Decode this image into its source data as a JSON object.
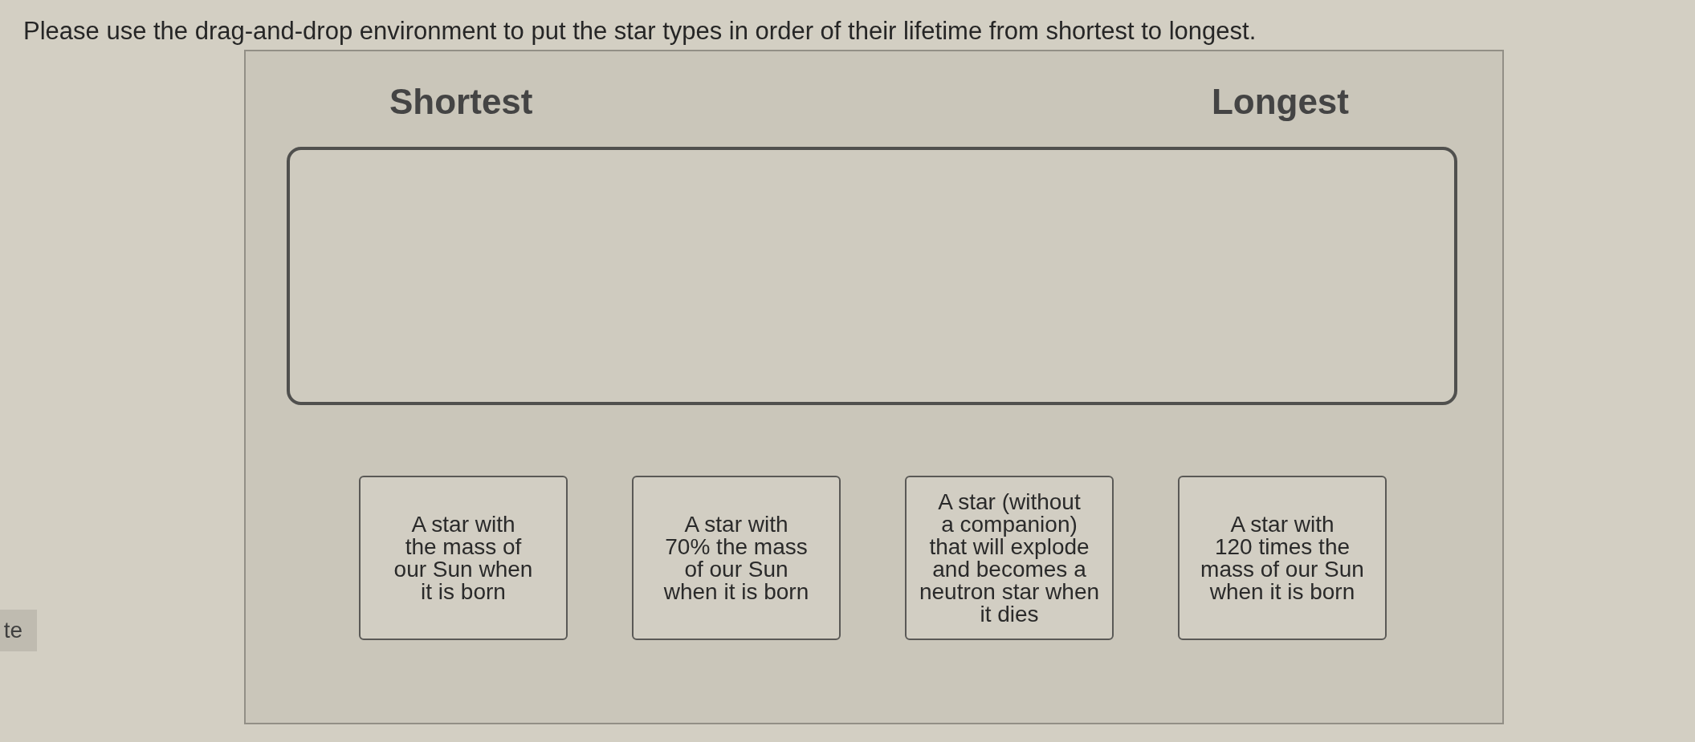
{
  "instruction": "Please use the drag-and-drop environment to put the star types in order of their lifetime from shortest to longest.",
  "side_button": {
    "label": "te"
  },
  "activity": {
    "scale_labels": [
      "Shortest",
      "Longest"
    ],
    "cards": [
      {
        "text": "A star with\nthe mass of\nour Sun when\nit is born"
      },
      {
        "text": "A star with\n70% the mass\nof our Sun\nwhen it is born"
      },
      {
        "text": "A star (without\na companion)\nthat will explode\nand becomes a\nneutron star when\nit dies"
      },
      {
        "text": "A star with\n120 times the\nmass of our Sun\nwhen it is born"
      }
    ]
  }
}
